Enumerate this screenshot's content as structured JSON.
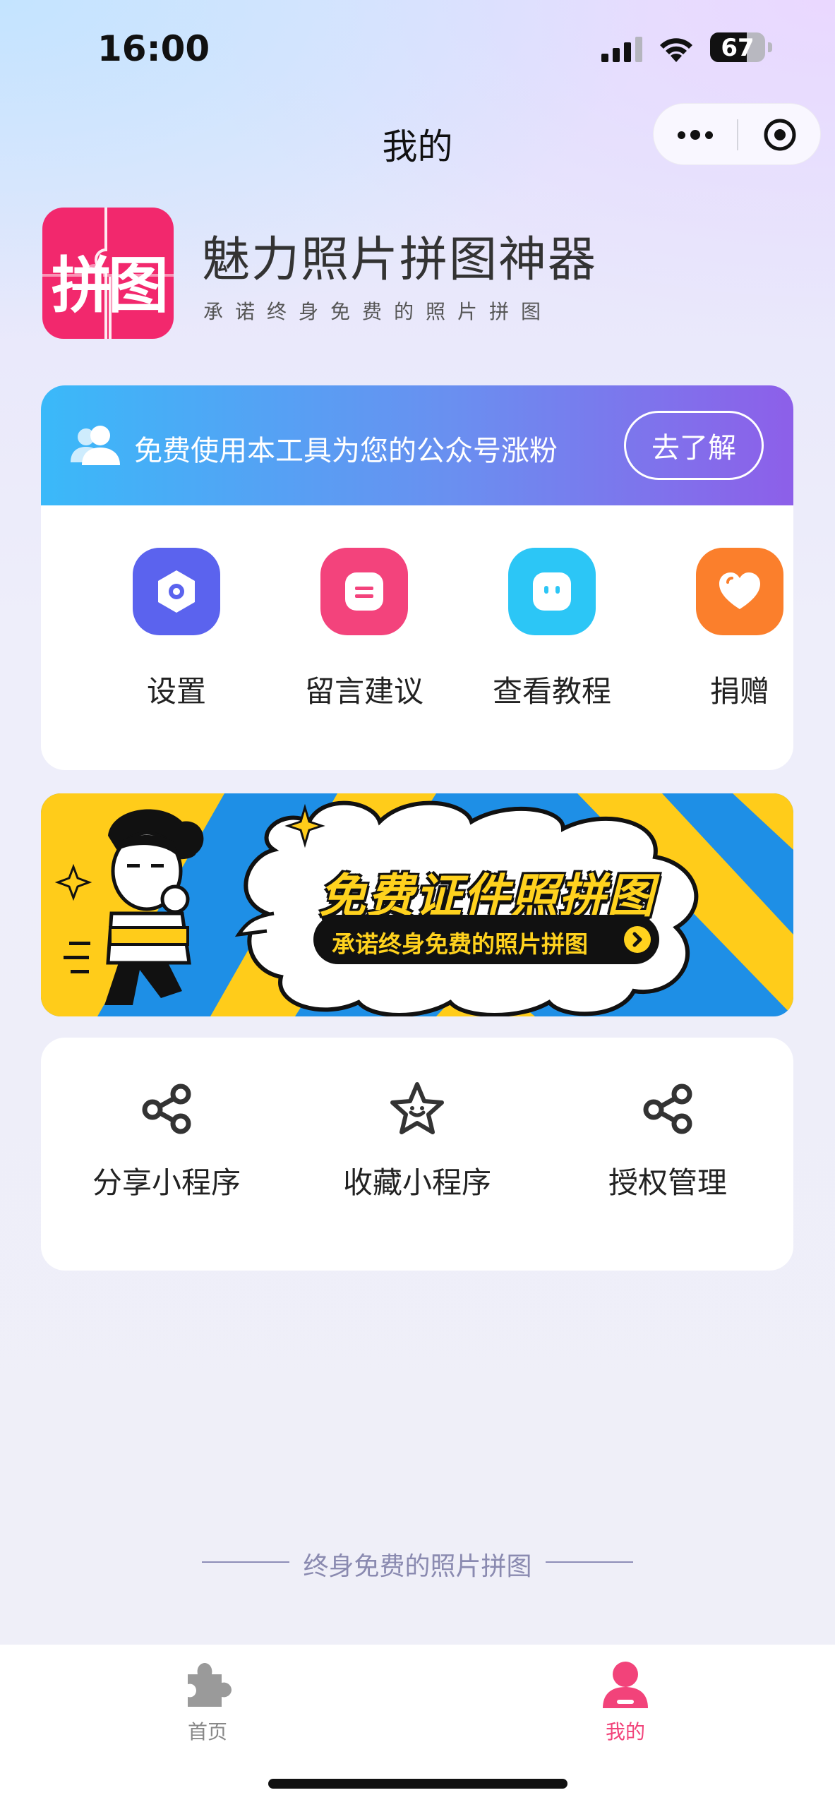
{
  "status_bar": {
    "time": "16:00",
    "battery": "67",
    "battery_level": 0.67
  },
  "nav": {
    "title": "我的"
  },
  "app": {
    "logo_text": "拼图",
    "name": "魅力照片拼图神器",
    "slogan": "承诺终身免费的照片拼图"
  },
  "promo": {
    "text": "免费使用本工具为您的公众号涨粉",
    "button": "去了解"
  },
  "menu": [
    {
      "label": "设置",
      "icon": "settings-icon",
      "color": "#5b63ee"
    },
    {
      "label": "留言建议",
      "icon": "message-icon",
      "color": "#f3437c"
    },
    {
      "label": "查看教程",
      "icon": "tutorial-icon",
      "color": "#2cc6f6"
    },
    {
      "label": "捐赠",
      "icon": "heart-icon",
      "color": "#fb7f2c"
    }
  ],
  "ad": {
    "title": "免费证件照拼图",
    "subtitle": "承诺终身免费的照片拼图"
  },
  "actions": [
    {
      "label": "分享小程序",
      "icon": "share-icon"
    },
    {
      "label": "收藏小程序",
      "icon": "star-icon"
    },
    {
      "label": "授权管理",
      "icon": "share-icon"
    }
  ],
  "footer": {
    "slogan": "终身免费的照片拼图"
  },
  "tabbar": {
    "items": [
      {
        "label": "首页",
        "icon": "puzzle-icon",
        "active": false
      },
      {
        "label": "我的",
        "icon": "user-icon",
        "active": true
      }
    ],
    "active_color": "#f2437a",
    "inactive_color": "#888888"
  }
}
